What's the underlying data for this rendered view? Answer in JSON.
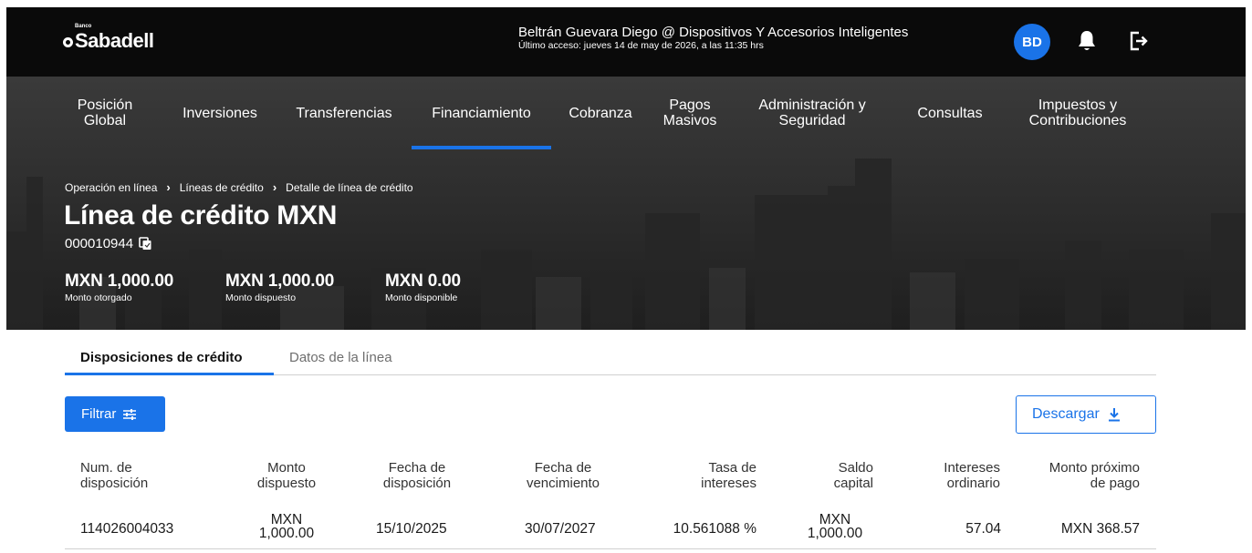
{
  "header": {
    "logo_small": "Banco",
    "logo_name": "Sabadell",
    "user_name": "Beltrán Guevara Diego @ Dispositivos Y Accesorios Inteligentes",
    "last_access": "Último acceso: jueves 14 de may de 2026, a las 11:35 hrs",
    "avatar_initials": "BD",
    "bell_icon": "bell-icon",
    "logout_icon": "logout-icon"
  },
  "nav": {
    "items": [
      {
        "line1": "Posición",
        "line2": "Global"
      },
      {
        "line1": "Inversiones",
        "line2": ""
      },
      {
        "line1": "Transferencias",
        "line2": ""
      },
      {
        "line1": "Financiamiento",
        "line2": ""
      },
      {
        "line1": "Cobranza",
        "line2": ""
      },
      {
        "line1": "Pagos",
        "line2": "Masivos"
      },
      {
        "line1": "Administración y",
        "line2": "Seguridad"
      },
      {
        "line1": "Consultas",
        "line2": ""
      },
      {
        "line1": "Impuestos y",
        "line2": "Contribuciones"
      }
    ],
    "active_index": 3
  },
  "breadcrumb": [
    "Operación en línea",
    "Líneas de crédito",
    "Detalle de línea de crédito"
  ],
  "page": {
    "title": "Línea de crédito MXN",
    "account_number": "000010944",
    "copy_icon": "copy-icon"
  },
  "amounts": [
    {
      "value": "MXN 1,000.00",
      "label": "Monto otorgado"
    },
    {
      "value": "MXN 1,000.00",
      "label": "Monto dispuesto"
    },
    {
      "value": "MXN 0.00",
      "label": "Monto disponible"
    }
  ],
  "tabs": {
    "active": "Disposiciones de crédito",
    "inactive": "Datos de la línea"
  },
  "buttons": {
    "filter_label": "Filtrar",
    "filter_icon": "sliders-icon",
    "download_label": "Descargar",
    "download_icon": "download-icon"
  },
  "table": {
    "headers": [
      {
        "line1": "Num. de",
        "line2": "disposición"
      },
      {
        "line1": "Monto",
        "line2": "dispuesto"
      },
      {
        "line1": "Fecha de",
        "line2": "disposición"
      },
      {
        "line1": "Fecha de",
        "line2": "vencimiento"
      },
      {
        "line1": "Tasa de",
        "line2": "intereses"
      },
      {
        "line1": "Saldo",
        "line2": "capital"
      },
      {
        "line1": "Intereses",
        "line2": "ordinario"
      },
      {
        "line1": "Monto próximo",
        "line2": "de pago"
      }
    ],
    "rows": [
      {
        "num": "114026004033",
        "monto_line1": "MXN",
        "monto_line2": "1,000.00",
        "fecha_disposicion": "15/10/2025",
        "fecha_vencimiento": "30/07/2027",
        "tasa": "10.561088 %",
        "saldo_line1": "MXN",
        "saldo_line2": "1,000.00",
        "intereses": "57.04",
        "proximo_pago": "MXN 368.57"
      }
    ]
  }
}
